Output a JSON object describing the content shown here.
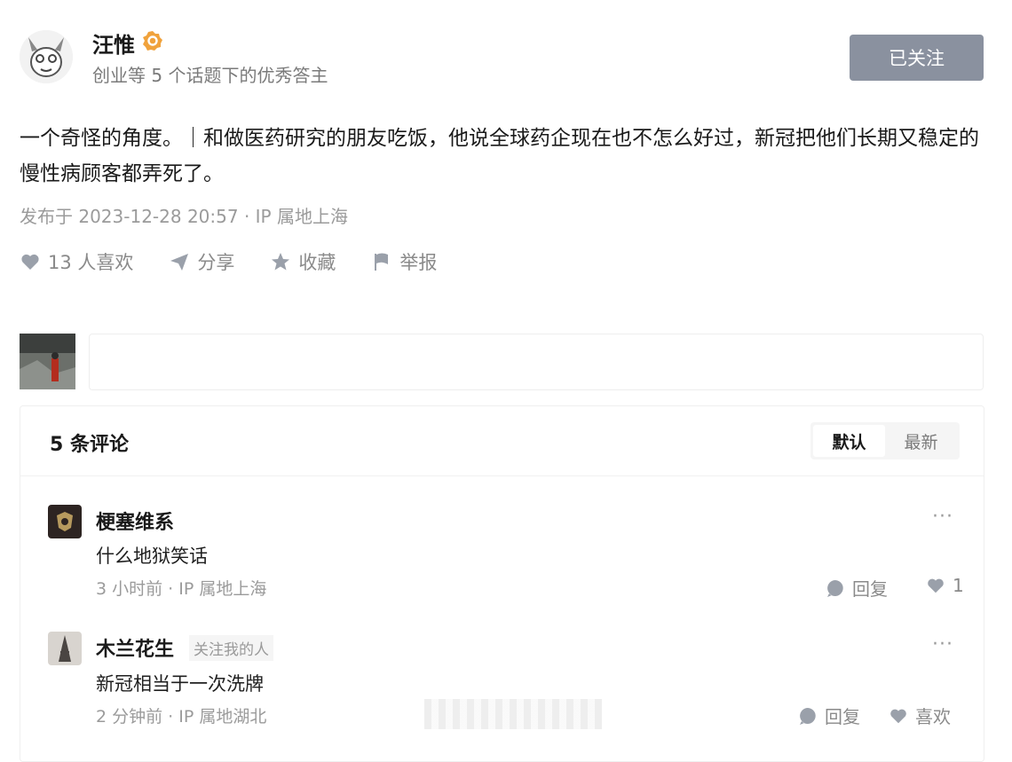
{
  "author": {
    "name": "汪惟",
    "subtitle": "创业等 5 个话题下的优秀答主",
    "follow_label": "已关注"
  },
  "post": {
    "text": "一个奇怪的角度。｜和做医药研究的朋友吃饭，他说全球药企现在也不怎么好过，新冠把他们长期又稳定的慢性病顾客都弄死了。",
    "meta": "发布于 2023-12-28 20:57 · IP 属地上海"
  },
  "actions": {
    "like": "13 人喜欢",
    "share": "分享",
    "collect": "收藏",
    "report": "举报"
  },
  "comment_input": {
    "placeholder": ""
  },
  "comments_panel": {
    "title": "5 条评论",
    "sort_default": "默认",
    "sort_latest": "最新"
  },
  "comments": [
    {
      "name": "梗塞维系",
      "tag": "",
      "text": "什么地狱笑话",
      "meta": "3 小时前 · IP 属地上海",
      "reply": "回复",
      "like": "1"
    },
    {
      "name": "木兰花生",
      "tag": "关注我的人",
      "text": "新冠相当于一次洗牌",
      "meta": "2 分钟前 · IP 属地湖北",
      "reply": "回复",
      "like": "喜欢"
    }
  ],
  "colors": {
    "follow_bg": "#8a919f",
    "badge": "#f0a23c",
    "muted": "#9b9b9b"
  }
}
